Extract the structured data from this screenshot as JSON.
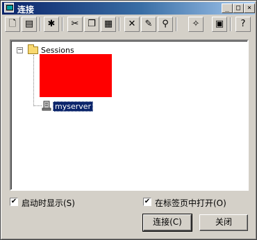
{
  "window": {
    "title": "连接"
  },
  "titlebar_buttons": [
    "_",
    "□",
    "×"
  ],
  "toolbar": {
    "tools": [
      "new-session-icon",
      "properties-icon",
      "new-folder-icon",
      "cut-icon",
      "copy-icon",
      "paste-icon",
      "delete-icon",
      "rename-icon",
      "find-icon",
      "desktop-shortcut-icon",
      "session-settings-icon",
      "help-icon"
    ]
  },
  "tree": {
    "root_label": "Sessions",
    "root_expander": "−",
    "server_label": "myserver"
  },
  "options": {
    "show_on_startup_label": "启动时显示(S)",
    "show_on_startup_checked": true,
    "open_in_tab_label": "在标签页中打开(O)",
    "open_in_tab_checked": true
  },
  "buttons": {
    "connect_label": "连接(C)",
    "close_label": "关闭"
  }
}
